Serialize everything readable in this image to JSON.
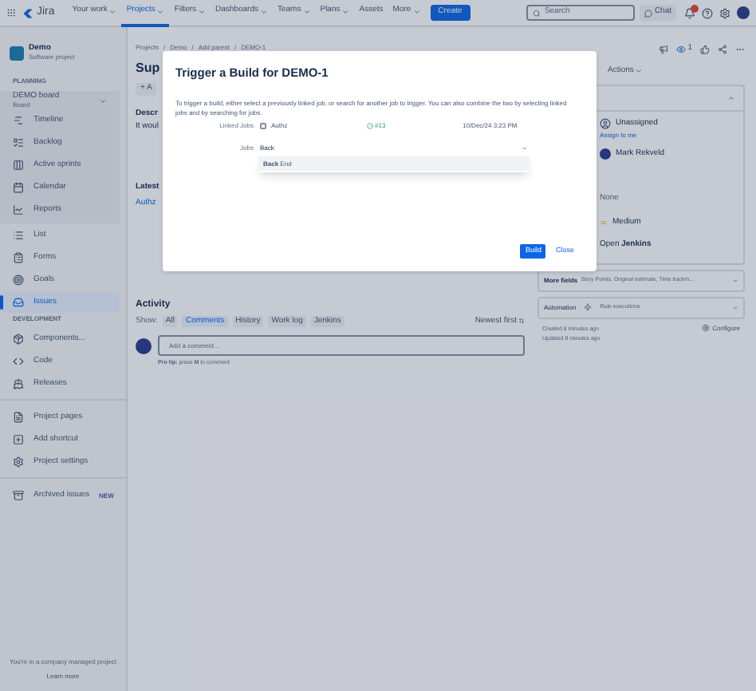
{
  "nav": {
    "app_name": "Jira",
    "menu": [
      {
        "label": "Your work",
        "selected": false,
        "caret": true
      },
      {
        "label": "Projects",
        "selected": true,
        "caret": true
      },
      {
        "label": "Filters",
        "selected": false,
        "caret": true
      },
      {
        "label": "Dashboards",
        "selected": false,
        "caret": true
      },
      {
        "label": "Teams",
        "selected": false,
        "caret": true
      },
      {
        "label": "Plans",
        "selected": false,
        "caret": true
      },
      {
        "label": "Assets",
        "selected": false,
        "caret": false
      },
      {
        "label": "More",
        "selected": false,
        "caret": true
      }
    ],
    "create_label": "Create",
    "search": {
      "placeholder": "Search"
    },
    "chat_label": "Chat"
  },
  "sidebar": {
    "project": {
      "name": "Demo",
      "type": "Software project"
    },
    "groups": [
      {
        "heading": "PLANNING",
        "board": {
          "name": "DEMO board",
          "subtitle": "Board"
        },
        "items": [
          {
            "label": "Timeline",
            "selected": false
          },
          {
            "label": "Backlog",
            "selected": false
          },
          {
            "label": "Active sprints",
            "selected": false
          },
          {
            "label": "Calendar",
            "selected": false
          },
          {
            "label": "Reports",
            "selected": false
          }
        ]
      },
      {
        "items": [
          {
            "label": "List",
            "selected": false
          },
          {
            "label": "Forms",
            "selected": false
          },
          {
            "label": "Goals",
            "selected": false
          },
          {
            "label": "Issues",
            "selected": true
          }
        ]
      },
      {
        "heading": "DEVELOPMENT",
        "items": [
          {
            "label": "Components...",
            "selected": false
          },
          {
            "label": "Code",
            "selected": false
          },
          {
            "label": "Releases",
            "selected": false
          }
        ]
      },
      {
        "divider": true,
        "items": [
          {
            "label": "Project pages",
            "selected": false
          },
          {
            "label": "Add shortcut",
            "selected": false
          },
          {
            "label": "Project settings",
            "selected": false
          }
        ]
      },
      {
        "divider": true,
        "items": [
          {
            "label": "Archived issues",
            "selected": false,
            "badge": "NEW"
          }
        ]
      }
    ],
    "footer": {
      "text": "You're in a company managed project",
      "link": "Learn more"
    }
  },
  "breadcrumbs": [
    {
      "label": "Projects"
    },
    {
      "separator": "/",
      "label": "Demo"
    },
    {
      "separator": "/",
      "label": "Add parent"
    },
    {
      "separator": "/",
      "label": "DEMO-1"
    }
  ],
  "issue": {
    "title": "Sup",
    "add_label": "+ A",
    "description_heading": "Descr",
    "description_text": "It woul",
    "latest_heading": "Latest",
    "latest_link": "Authz"
  },
  "header_actions": {
    "watchers": "1",
    "actions_label": "Actions"
  },
  "details": {
    "assignee": "Unassigned",
    "assign_link": "Assign to me",
    "reporter": "Mark Rekveld",
    "labels": "None",
    "priority": "Medium",
    "dev_prefix": "Open",
    "dev_link": "Jenkins"
  },
  "more_fields": {
    "label": "More fields",
    "hint": "Story Points, Original estimate, Time trackin..."
  },
  "automation": {
    "label": "Automation",
    "hint": "Rule executions"
  },
  "timestamps": {
    "created": "Created 8 minutes ago",
    "updated": "Updated 8 minutes ago",
    "configure": "Configure"
  },
  "activity": {
    "heading": "Activity",
    "show_label": "Show:",
    "tabs": [
      {
        "label": "All",
        "selected": false
      },
      {
        "label": "Comments",
        "selected": true
      },
      {
        "label": "History",
        "selected": false
      },
      {
        "label": "Work log",
        "selected": false
      },
      {
        "label": "Jenkins",
        "selected": false
      }
    ],
    "sort_label": "Newest first",
    "comment_placeholder": "Add a comment...",
    "tip": "**Pro tip:** press **M** to comment"
  },
  "dialog": {
    "title": "Trigger a Build for DEMO-1",
    "description": "To trigger a build, either select a previously linked job, or search for another job to trigger. You can also combine the two by selecting linked jobs and by searching for jobs.",
    "linked_jobs_label": "Linked Jobs",
    "linked_jobs": [
      {
        "name": "Authz",
        "checked": false,
        "build": "#13",
        "time": "10/Dec/24 3:23 PM"
      }
    ],
    "jobs_label": "Jobs",
    "jobs_value": "Back",
    "options": [
      "**Back** End"
    ],
    "build_label": "Build",
    "close_label": "Close"
  }
}
